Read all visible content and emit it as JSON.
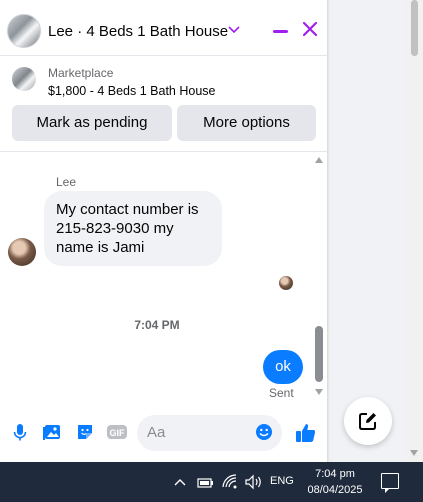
{
  "header": {
    "title": "Lee · 4 Beds 1 Bath House",
    "chevron": "chevron-down-icon",
    "minimize": "minimize-icon",
    "close": "close-icon"
  },
  "marketplace": {
    "label": "Marketplace",
    "listing": "$1,800 - 4 Beds 1 Bath House",
    "mark_pending": "Mark as pending",
    "more_options": "More options"
  },
  "conversation": {
    "sender": "Lee",
    "incoming": "My contact number is 215-823-9030 my name is Jami",
    "timestamp": "7:04 PM",
    "outgoing": "ok",
    "status": "Sent"
  },
  "composer": {
    "placeholder": "Aa",
    "icons": [
      "microphone-icon",
      "photo-icon",
      "sticker-icon",
      "gif-icon",
      "emoji-icon",
      "thumbs-up-icon"
    ],
    "gif_label": "GIF"
  },
  "taskbar": {
    "language": "ENG",
    "time": "7:04 pm",
    "date": "08/04/2025"
  },
  "colors": {
    "accent": "#a020f0",
    "messenger_blue": "#0a7cff",
    "taskbar": "#1f2a3c"
  }
}
